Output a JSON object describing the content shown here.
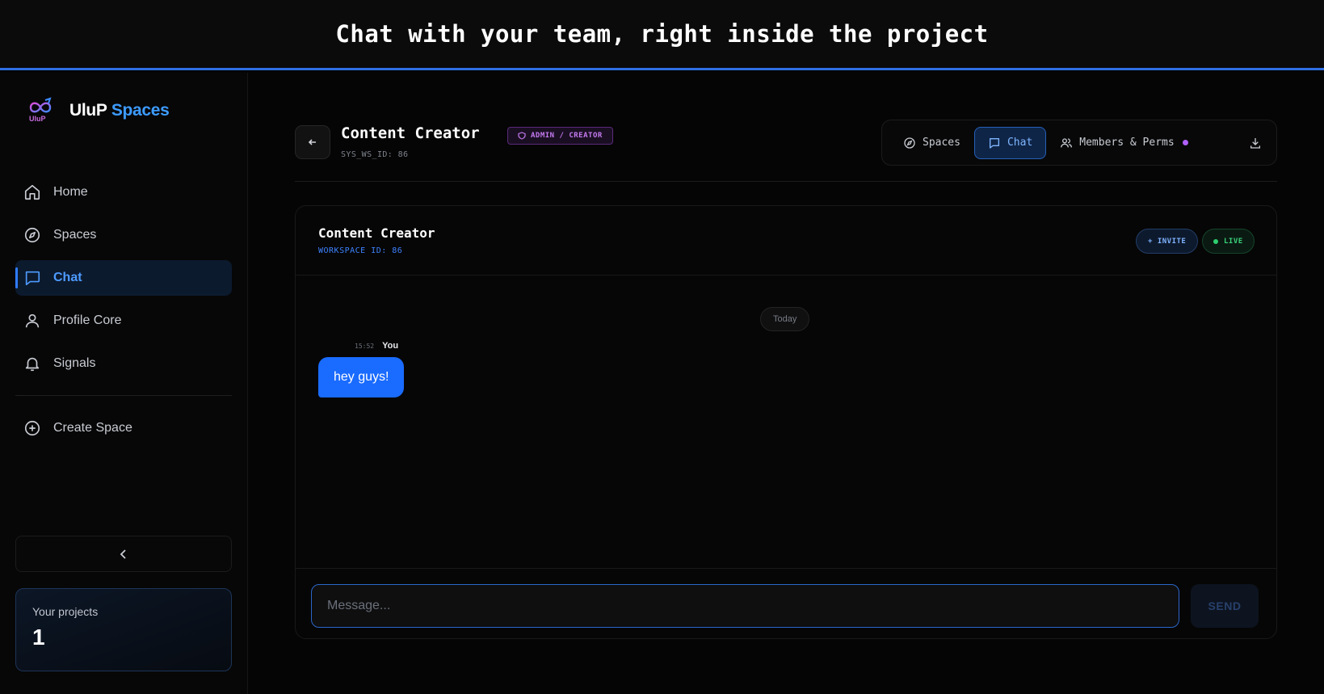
{
  "banner": {
    "title": "Chat with your team, right inside the project"
  },
  "brand": {
    "name": "UluP",
    "accent": "Spaces",
    "accent_color": "#3d9bff"
  },
  "sidebar": {
    "items": [
      {
        "label": "Home",
        "icon": "home-icon",
        "active": false
      },
      {
        "label": "Spaces",
        "icon": "compass-icon",
        "active": false
      },
      {
        "label": "Chat",
        "icon": "chat-bubble-icon",
        "active": true
      },
      {
        "label": "Profile Core",
        "icon": "user-icon",
        "active": false
      },
      {
        "label": "Signals",
        "icon": "bell-icon",
        "active": false
      }
    ],
    "create_space": {
      "label": "Create Space",
      "icon": "plus-circle-icon"
    },
    "collapse_icon": "chevron-left-icon",
    "projects": {
      "label": "Your projects",
      "count": "1"
    }
  },
  "workspace": {
    "back_icon": "arrow-left-icon",
    "title": "Content Creator",
    "role_badge": "ADMIN / CREATOR",
    "sys_id": "SYS_WS_ID: 86"
  },
  "toolbar": {
    "spaces_label": "Spaces",
    "chat_label": "Chat",
    "members_label": "Members & Perms",
    "download_icon": "download-icon",
    "active_color": "#2660b8"
  },
  "chat": {
    "title": "Content Creator",
    "workspace_id": "WORKSPACE ID: 86",
    "invite_label": "+ INVITE",
    "live_label": "LIVE",
    "live_color": "#3bd17a",
    "date_divider": "Today",
    "messages": [
      {
        "time": "15:52",
        "author": "You",
        "text": "hey guys!",
        "bubble_color": "#1a6bff"
      }
    ],
    "composer": {
      "placeholder": "Message...",
      "value": "",
      "send_label": "SEND"
    }
  }
}
